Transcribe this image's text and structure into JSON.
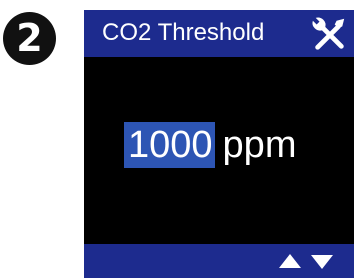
{
  "step": {
    "number": "2"
  },
  "screen": {
    "title": "CO2 Threshold",
    "title_icon": "wrench-screwdriver-icon",
    "value": "1000",
    "unit": "ppm",
    "nav_icons": [
      "arrow-up-icon",
      "arrow-down-icon"
    ]
  },
  "colors": {
    "bar": "#1d2b8e",
    "screen_bg": "#000000",
    "value_highlight": "#2d55b4",
    "text": "#ffffff"
  }
}
